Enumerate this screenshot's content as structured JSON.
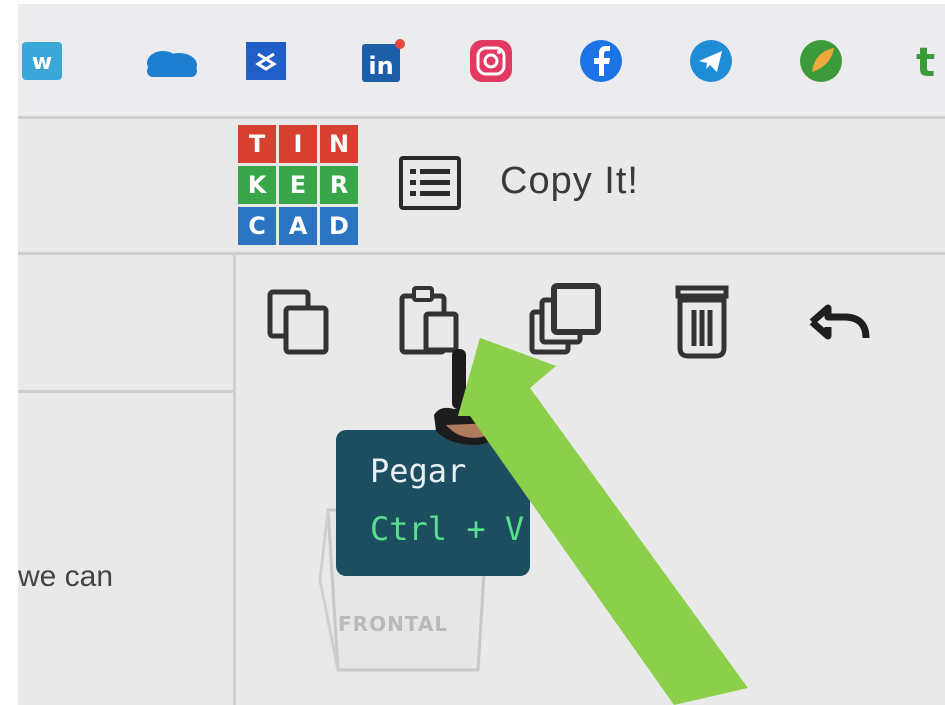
{
  "bookmarks": [
    {
      "icon": "wix-icon",
      "color": "#3aa7d8",
      "label": "w"
    },
    {
      "icon": "onedrive-icon",
      "color": "#1e7fd0"
    },
    {
      "icon": "dropbox-icon",
      "color": "#1f5fc7"
    },
    {
      "icon": "linkedin-icon",
      "color": "#1c5ea8",
      "label": "in"
    },
    {
      "icon": "instagram-icon",
      "color": "#e23a63"
    },
    {
      "icon": "facebook-icon",
      "color": "#1c73e6"
    },
    {
      "icon": "telegram-icon",
      "color": "#1f8dd6"
    },
    {
      "icon": "leaf-icon",
      "color": "#3c9a3a"
    },
    {
      "icon": "cropped-t-icon",
      "color": "#3c9a3a",
      "label": "t"
    }
  ],
  "logo": {
    "letters": [
      "T",
      "I",
      "N",
      "K",
      "E",
      "R",
      "C",
      "A",
      "D"
    ],
    "colors": [
      "#d8412f",
      "#d8412f",
      "#d8412f",
      "#3aa64a",
      "#3aa64a",
      "#3aa64a",
      "#2a74c2",
      "#2a74c2",
      "#2a74c2"
    ]
  },
  "header": {
    "design_name": "Copy It!",
    "menu_icon": "list-icon"
  },
  "toolbar": [
    {
      "name": "copy",
      "icon": "copy-icon"
    },
    {
      "name": "paste",
      "icon": "paste-icon"
    },
    {
      "name": "duplicate",
      "icon": "duplicate-icon"
    },
    {
      "name": "delete",
      "icon": "trash-icon"
    },
    {
      "name": "undo",
      "icon": "undo-icon"
    }
  ],
  "tooltip": {
    "title": "Pegar",
    "shortcut": "Ctrl + V",
    "bg_color": "#1d4e5f",
    "shortcut_color": "#58e08c"
  },
  "view_cube": {
    "label": "FRONTAL"
  },
  "sidebar": {
    "text": "we can"
  },
  "annotation": {
    "arrow_color": "#8ccf4a"
  }
}
